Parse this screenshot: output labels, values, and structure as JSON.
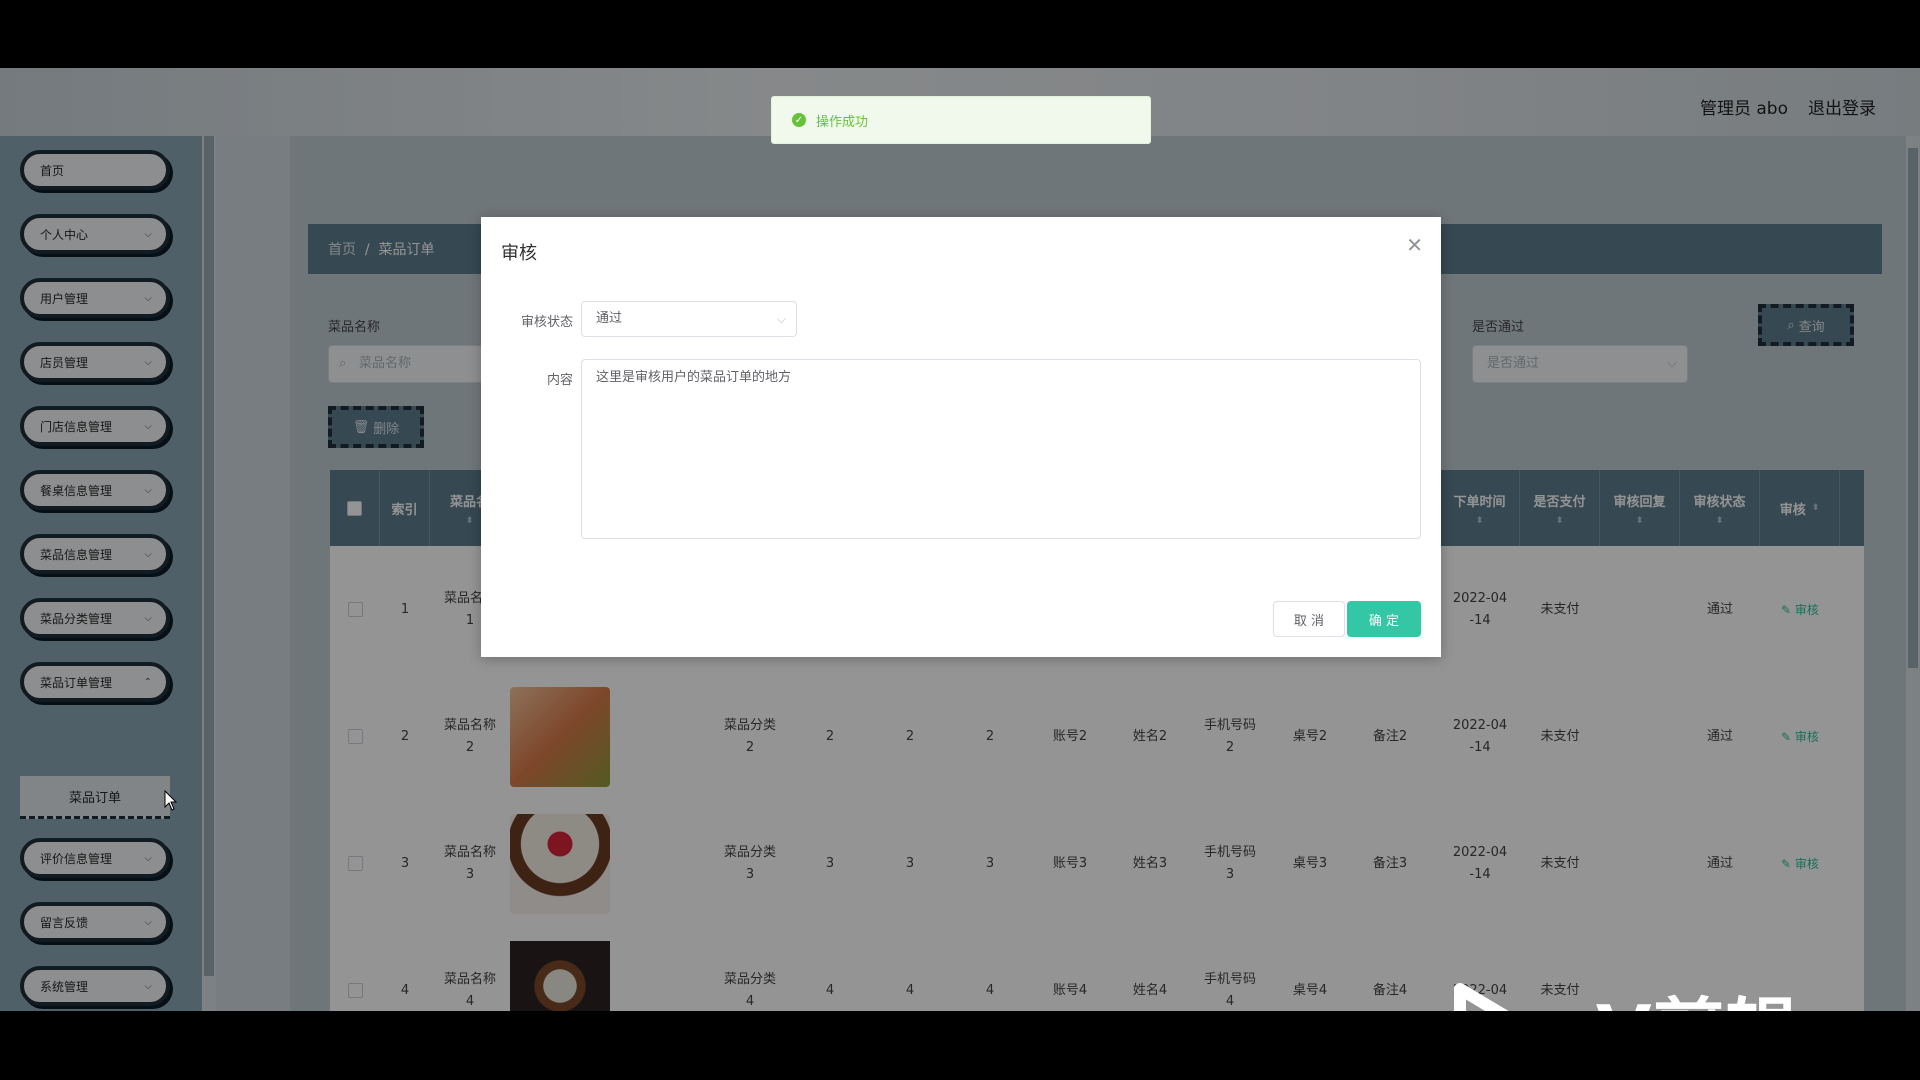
{
  "header": {
    "title": "",
    "user": "管理员 abo",
    "logout": "退出登录"
  },
  "sidebar": {
    "items": [
      {
        "label": "首页"
      },
      {
        "label": "个人中心"
      },
      {
        "label": "用户管理"
      },
      {
        "label": "店员管理"
      },
      {
        "label": "门店信息管理"
      },
      {
        "label": "餐桌信息管理"
      },
      {
        "label": "菜品信息管理"
      },
      {
        "label": "菜品分类管理"
      },
      {
        "label": "菜品订单管理"
      },
      {
        "label": "评价信息管理"
      },
      {
        "label": "留言反馈"
      },
      {
        "label": "系统管理"
      }
    ],
    "sub_item": "菜品订单"
  },
  "breadcrumb": {
    "home": "首页",
    "sep": "/",
    "current": "菜品订单"
  },
  "search": {
    "name_label": "菜品名称",
    "name_placeholder": "菜品名称",
    "pass_label": "是否通过",
    "pass_placeholder": "是否通过",
    "query_button": "查询",
    "delete_button": "删除"
  },
  "table": {
    "headers": {
      "index": "索引",
      "name": "菜品名",
      "order_time": "下单时间",
      "paid": "是否支付",
      "audit_reply": "审核回复",
      "audit_status": "审核状态",
      "audit": "审核"
    },
    "rows": [
      {
        "index": "1",
        "name": "菜品名称\n1",
        "category": "",
        "qty": "",
        "price": "",
        "total": "",
        "account": "",
        "realname": "",
        "phone": "",
        "table": "",
        "note": "",
        "time": "2022-04\n-14",
        "paid": "未支付",
        "status": "通过",
        "audit": "审核"
      },
      {
        "index": "2",
        "name": "菜品名称\n2",
        "category": "菜品分类\n2",
        "qty": "2",
        "price": "2",
        "total": "2",
        "account": "账号2",
        "realname": "姓名2",
        "phone": "手机号码\n2",
        "table": "桌号2",
        "note": "备注2",
        "time": "2022-04\n-14",
        "paid": "未支付",
        "status": "通过",
        "audit": "审核"
      },
      {
        "index": "3",
        "name": "菜品名称\n3",
        "category": "菜品分类\n3",
        "qty": "3",
        "price": "3",
        "total": "3",
        "account": "账号3",
        "realname": "姓名3",
        "phone": "手机号码\n3",
        "table": "桌号3",
        "note": "备注3",
        "time": "2022-04\n-14",
        "paid": "未支付",
        "status": "通过",
        "audit": "审核"
      },
      {
        "index": "4",
        "name": "菜品名称\n4",
        "category": "菜品分类\n4",
        "qty": "4",
        "price": "4",
        "total": "4",
        "account": "账号4",
        "realname": "姓名4",
        "phone": "手机号码\n4",
        "table": "桌号4",
        "note": "备注4",
        "time": "2022-04",
        "paid": "未支付",
        "status": "",
        "audit": ""
      }
    ]
  },
  "dialog": {
    "title": "审核",
    "status_label": "审核状态",
    "status_value": "通过",
    "content_label": "内容",
    "content_value": "这里是审核用户的菜品订单的地方",
    "cancel": "取 消",
    "ok": "确 定"
  },
  "toast": {
    "text": "操作成功"
  },
  "watermark": {
    "text": "eV剪辑"
  },
  "colors": {
    "accent": "#33c7a6",
    "theme": "#5e7d8e",
    "success": "#67c23a"
  }
}
